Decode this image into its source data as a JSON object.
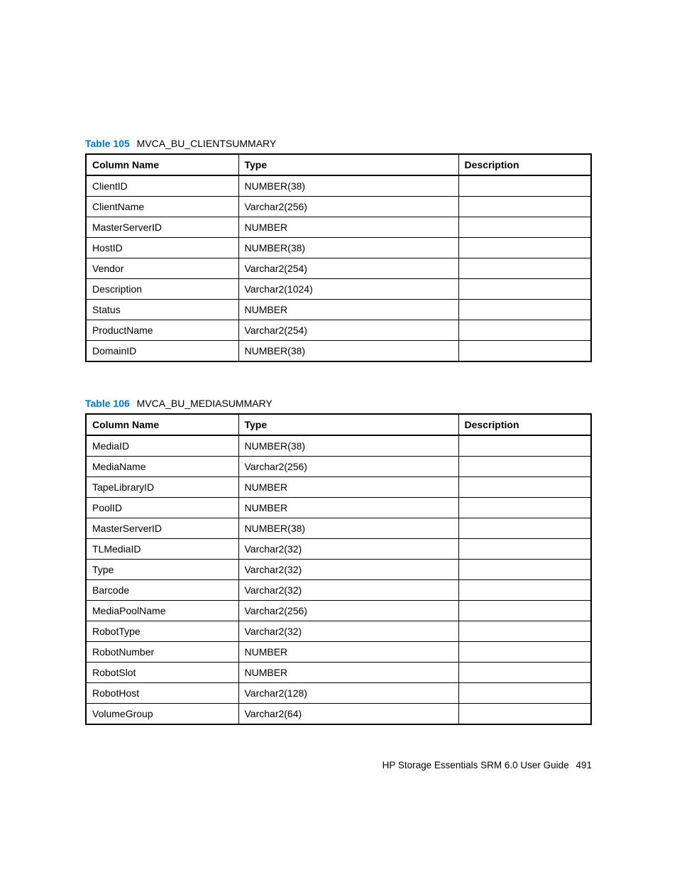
{
  "tables": [
    {
      "label": "Table 105",
      "title": "MVCA_BU_CLIENTSUMMARY",
      "headers": {
        "c0": "Column Name",
        "c1": "Type",
        "c2": "Description"
      },
      "rows": [
        {
          "name": "ClientID",
          "type": "NUMBER(38)",
          "desc": ""
        },
        {
          "name": "ClientName",
          "type": "Varchar2(256)",
          "desc": ""
        },
        {
          "name": "MasterServerID",
          "type": "NUMBER",
          "desc": ""
        },
        {
          "name": "HostID",
          "type": "NUMBER(38)",
          "desc": ""
        },
        {
          "name": "Vendor",
          "type": "Varchar2(254)",
          "desc": ""
        },
        {
          "name": "Description",
          "type": "Varchar2(1024)",
          "desc": ""
        },
        {
          "name": "Status",
          "type": "NUMBER",
          "desc": ""
        },
        {
          "name": "ProductName",
          "type": "Varchar2(254)",
          "desc": ""
        },
        {
          "name": "DomainID",
          "type": "NUMBER(38)",
          "desc": ""
        }
      ]
    },
    {
      "label": "Table 106",
      "title": "MVCA_BU_MEDIASUMMARY",
      "headers": {
        "c0": "Column Name",
        "c1": "Type",
        "c2": "Description"
      },
      "rows": [
        {
          "name": "MediaID",
          "type": "NUMBER(38)",
          "desc": ""
        },
        {
          "name": "MediaName",
          "type": "Varchar2(256)",
          "desc": ""
        },
        {
          "name": "TapeLibraryID",
          "type": "NUMBER",
          "desc": ""
        },
        {
          "name": "PoolID",
          "type": "NUMBER",
          "desc": ""
        },
        {
          "name": "MasterServerID",
          "type": "NUMBER(38)",
          "desc": ""
        },
        {
          "name": "TLMediaID",
          "type": "Varchar2(32)",
          "desc": ""
        },
        {
          "name": "Type",
          "type": "Varchar2(32)",
          "desc": ""
        },
        {
          "name": "Barcode",
          "type": "Varchar2(32)",
          "desc": ""
        },
        {
          "name": "MediaPoolName",
          "type": "Varchar2(256)",
          "desc": ""
        },
        {
          "name": "RobotType",
          "type": "Varchar2(32)",
          "desc": ""
        },
        {
          "name": "RobotNumber",
          "type": "NUMBER",
          "desc": ""
        },
        {
          "name": "RobotSlot",
          "type": "NUMBER",
          "desc": ""
        },
        {
          "name": "RobotHost",
          "type": "Varchar2(128)",
          "desc": ""
        },
        {
          "name": "VolumeGroup",
          "type": "Varchar2(64)",
          "desc": ""
        }
      ]
    }
  ],
  "footer": {
    "text": "HP Storage Essentials SRM 6.0 User Guide",
    "page": "491"
  }
}
